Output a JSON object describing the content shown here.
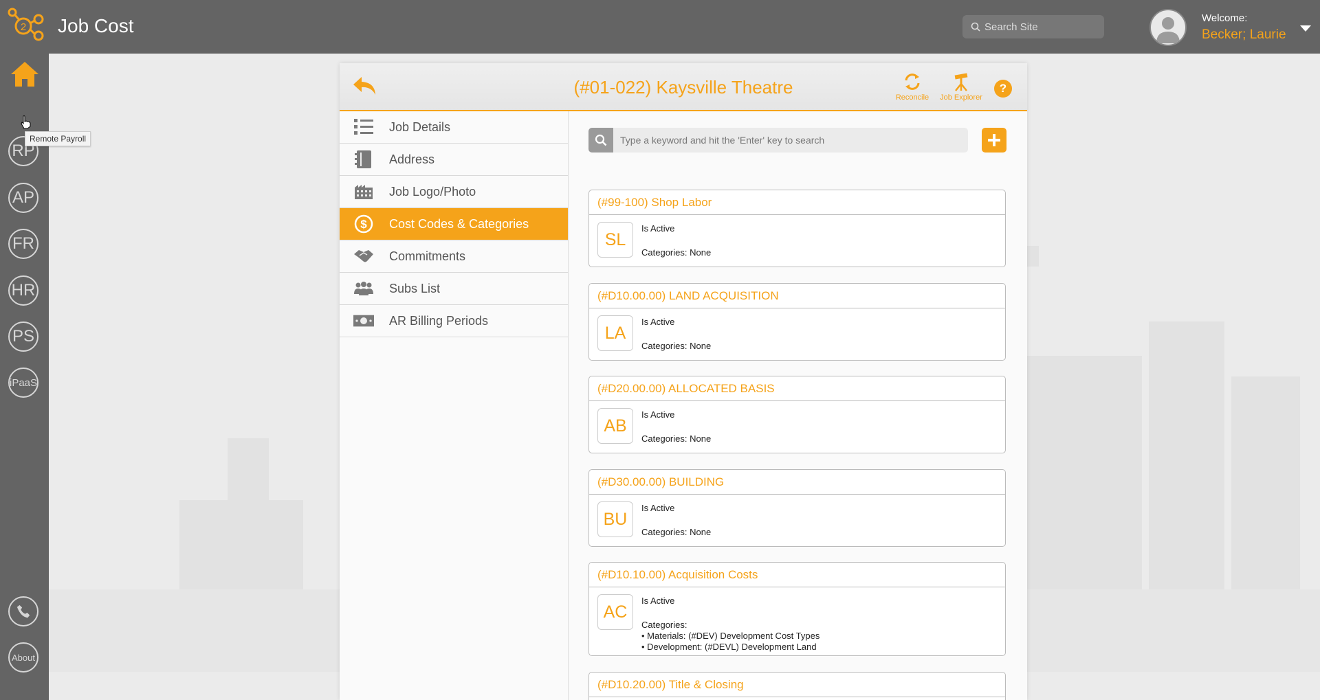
{
  "app": {
    "title": "Job Cost"
  },
  "search_site": {
    "placeholder": "Search Site"
  },
  "user": {
    "welcome_label": "Welcome:",
    "name": "Becker; Laurie"
  },
  "sidebar": {
    "items": [
      {
        "label": "RP",
        "icon": "remote-payroll"
      },
      {
        "label": "AP",
        "icon": "accounts-payable"
      },
      {
        "label": "FR",
        "icon": "fr"
      },
      {
        "label": "HR",
        "icon": "hr"
      },
      {
        "label": "PS",
        "icon": "ps"
      },
      {
        "label": "iPaaS",
        "icon": "ipaas"
      }
    ],
    "about_label": "About",
    "tooltip": "Remote Payroll"
  },
  "job": {
    "title": "(#01-022) Kaysville Theatre",
    "reconcile_label": "Reconcile",
    "explorer_label": "Job Explorer",
    "help_label": "?"
  },
  "menu": {
    "items": [
      {
        "label": "Job Details",
        "icon": "list-icon"
      },
      {
        "label": "Address",
        "icon": "address-book-icon"
      },
      {
        "label": "Job Logo/Photo",
        "icon": "building-icon"
      },
      {
        "label": "Cost Codes & Categories",
        "icon": "dollar-coin-icon",
        "active": true
      },
      {
        "label": "Commitments",
        "icon": "handshake-icon"
      },
      {
        "label": "Subs List",
        "icon": "people-icon"
      },
      {
        "label": "AR Billing Periods",
        "icon": "banknote-icon"
      }
    ]
  },
  "keyword_search": {
    "placeholder": "Type a keyword and hit the 'Enter' key to search"
  },
  "cost_codes": [
    {
      "title": "(#99-100) Shop Labor",
      "abbr": "SL",
      "status": "Is Active",
      "categories": [
        "Categories: None"
      ]
    },
    {
      "title": "(#D10.00.00) LAND ACQUISITION",
      "abbr": "LA",
      "status": "Is Active",
      "categories": [
        "Categories: None"
      ]
    },
    {
      "title": "(#D20.00.00) ALLOCATED BASIS",
      "abbr": "AB",
      "status": "Is Active",
      "categories": [
        "Categories: None"
      ]
    },
    {
      "title": "(#D30.00.00) BUILDING",
      "abbr": "BU",
      "status": "Is Active",
      "categories": [
        "Categories: None"
      ]
    },
    {
      "title": "(#D10.10.00) Acquisition Costs",
      "abbr": "AC",
      "status": "Is Active",
      "categories": [
        "Categories:",
        "• Materials: (#DEV) Development Cost Types",
        "• Development: (#DEVL) Development Land"
      ]
    },
    {
      "title": "(#D10.20.00) Title & Closing",
      "abbr": "",
      "status": "",
      "categories": []
    }
  ],
  "colors": {
    "accent": "#f5a31a",
    "topbar": "#646464"
  }
}
